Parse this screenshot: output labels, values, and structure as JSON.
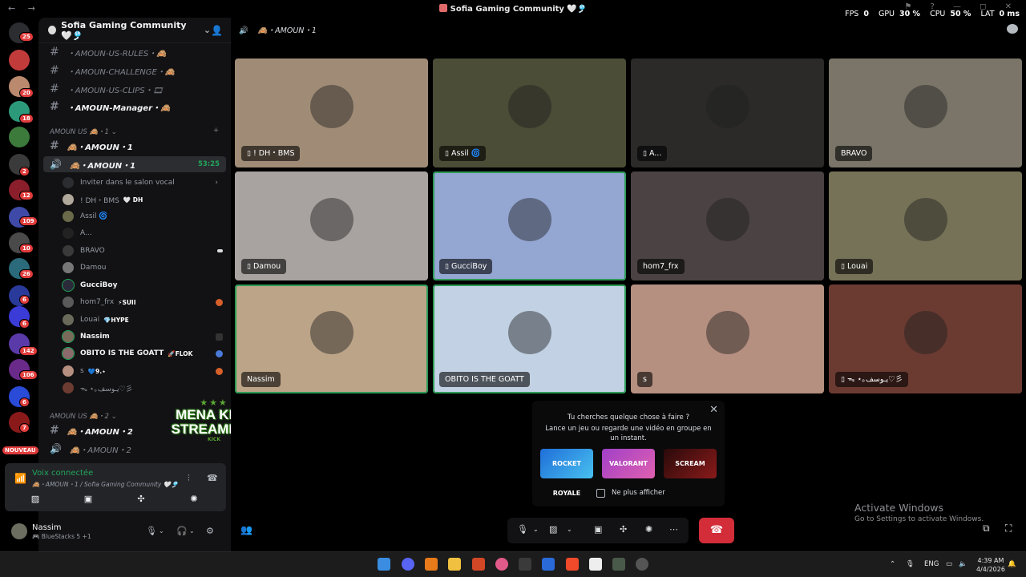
{
  "window": {
    "title": "Sofia Gaming Community 🤍🎐",
    "hud": {
      "fps_label": "FPS",
      "fps": "0",
      "gpu_label": "GPU",
      "gpu": "30 %",
      "cpu_label": "CPU",
      "cpu": "50 %",
      "lat_label": "LAT",
      "lat": "0 ms"
    }
  },
  "rail": {
    "badges": [
      "25",
      "20",
      "18",
      "2",
      "12",
      "109",
      "10",
      "26",
      "6",
      "6",
      "142",
      "106",
      "6",
      "7"
    ],
    "nouveau": "NOUVEAU"
  },
  "sidebar": {
    "server_name": "Sofia Gaming Community 🤍🎐",
    "channels": [
      {
        "label": "・AMOUN-US-RULES・🙈"
      },
      {
        "label": "・AMOUN-CHALLENGE・🙈"
      },
      {
        "label": "・AMOUN-US-CLIPS・🎞"
      },
      {
        "label": "・AMOUN-Manager・🙈"
      }
    ],
    "category1": {
      "label": "AMOUN US 🙈・1",
      "plus": "+"
    },
    "cat1_channels": [
      {
        "label": "🙈・AMOUN・1"
      },
      {
        "label": "🙈・AMOUN・1",
        "timer": "53:25"
      }
    ],
    "invite": "Inviter dans le salon vocal",
    "voice_users": [
      {
        "name": "! DH・BMS",
        "tag": "🤍 DH"
      },
      {
        "name": "Assil 🌀",
        "tag": ""
      },
      {
        "name": "A...",
        "tag": ""
      },
      {
        "name": "BRAVO",
        "tag": ""
      },
      {
        "name": "Damou",
        "tag": ""
      },
      {
        "name": "GucciBoy",
        "tag": ""
      },
      {
        "name": "hom7_frx",
        "tag": "⚡SUII"
      },
      {
        "name": "Louai",
        "tag": "💎HYPE"
      },
      {
        "name": "Nassim",
        "tag": ""
      },
      {
        "name": "OBITO IS THE GOATT",
        "tag": "🚀FLOK"
      },
      {
        "name": "s",
        "tag": "💙9.⋆"
      },
      {
        "name": "ᯓ ⋆｡يـوسف♡彡",
        "tag": ""
      }
    ],
    "category2": {
      "label": "AMOUN US 🙈・2"
    },
    "cat2_channels": [
      {
        "label": "🙈・AMOUN・2"
      },
      {
        "label": "🙈・AMOUN・2"
      }
    ],
    "logo_text": "MENA KICK STREAMERS",
    "logo_sub": "KICK",
    "voice_status": "Voix connectée",
    "voice_sub": "🙈・AMOUN・1 / Sofia Gaming Community 🤍🎐",
    "user": {
      "name": "Nassim",
      "status": "🎮 BlueStacks 5 +1"
    }
  },
  "main": {
    "header": "🙈・AMOUN・1",
    "tiles": [
      {
        "name": "! DH・BMS",
        "mobile": true,
        "bg": "#a08c76"
      },
      {
        "name": "Assil 🌀",
        "mobile": true,
        "bg": "#4b4d36"
      },
      {
        "name": "A...",
        "mobile": true,
        "bg": "#2b2a28"
      },
      {
        "name": "BRAVO",
        "mobile": false,
        "bg": "#7a7568"
      },
      {
        "name": "Damou",
        "mobile": true,
        "bg": "#a8a3a0"
      },
      {
        "name": "GucciBoy",
        "mobile": true,
        "bg": "#94a6d2"
      },
      {
        "name": "hom7_frx",
        "mobile": false,
        "bg": "#4a4243"
      },
      {
        "name": "Louai",
        "mobile": true,
        "bg": "#767257"
      },
      {
        "name": "Nassim",
        "mobile": false,
        "bg": "#bca488"
      },
      {
        "name": "OBITO IS THE GOATT",
        "mobile": false,
        "bg": "#c2d2e4"
      },
      {
        "name": "s",
        "mobile": false,
        "bg": "#b58f80"
      },
      {
        "name": "ᯓ ⋆｡يـوسف♡彡",
        "mobile": true,
        "bg": "#6b3b32"
      }
    ],
    "popup": {
      "line1": "Tu cherches quelque chose à faire ?",
      "line2": "Lance un jeu ou regarde une vidéo en groupe en un instant.",
      "activities": [
        "ROCKET ROYALE",
        "VALORANT",
        "SCREAM"
      ],
      "checkbox": "Ne plus afficher"
    },
    "activate": {
      "title": "Activate Windows",
      "sub": "Go to Settings to activate Windows."
    }
  },
  "taskbar": {
    "lang": "ENG",
    "time": "4:39 AM",
    "date": "4/4/2026"
  }
}
